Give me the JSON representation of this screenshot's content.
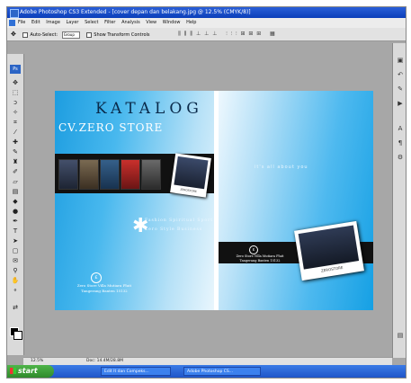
{
  "window": {
    "title": "Adobe Photoshop CS3 Extended - [cover depan dan belakang.jpg @ 12.5% (CMYK/8)]"
  },
  "menu": [
    "File",
    "Edit",
    "Image",
    "Layer",
    "Select",
    "Filter",
    "Analysis",
    "View",
    "Window",
    "Help"
  ],
  "options_bar": {
    "auto_select_label": "Auto-Select:",
    "auto_select_value": "Group",
    "show_transform_label": "Show Transform Controls"
  },
  "tools": [
    "move-tool",
    "marquee-tool",
    "lasso-tool",
    "magic-wand-tool",
    "crop-tool",
    "slice-tool",
    "healing-brush-tool",
    "brush-tool",
    "clone-stamp-tool",
    "history-brush-tool",
    "eraser-tool",
    "gradient-tool",
    "blur-tool",
    "dodge-tool",
    "pen-tool",
    "type-tool",
    "path-selection-tool",
    "shape-tool",
    "notes-tool",
    "eyedropper-tool",
    "hand-tool",
    "zoom-tool"
  ],
  "document": {
    "front": {
      "heading": "KATALOG",
      "subheading": "CV.ZERO STORE",
      "slogan": "Fashion Spiritual Sport Zero Style Business",
      "address": "Zero Store Villa Mutiara Pluit Tangerang Banten 15132",
      "polaroid_caption": "ZEROSTORE"
    },
    "back": {
      "tagline": "it's all about you",
      "address": "Zero Store Villa Mutiara Pluit Tangerang Banten 15132",
      "polaroid_caption": "ZEROSTORE"
    }
  },
  "status": {
    "zoom": "12.5%",
    "doc_size": "Doc: 14.4M/28.8M"
  },
  "taskbar": {
    "start_label": "start",
    "tasks": [
      "Edit It dan Compeks...",
      "Adobe Photoshop CS..."
    ]
  },
  "colors": {
    "titlebar": "#0b3fb9",
    "cover_blue": "#1d9de0",
    "taskbar": "#1f55c8",
    "start_green": "#2f8a2b"
  }
}
